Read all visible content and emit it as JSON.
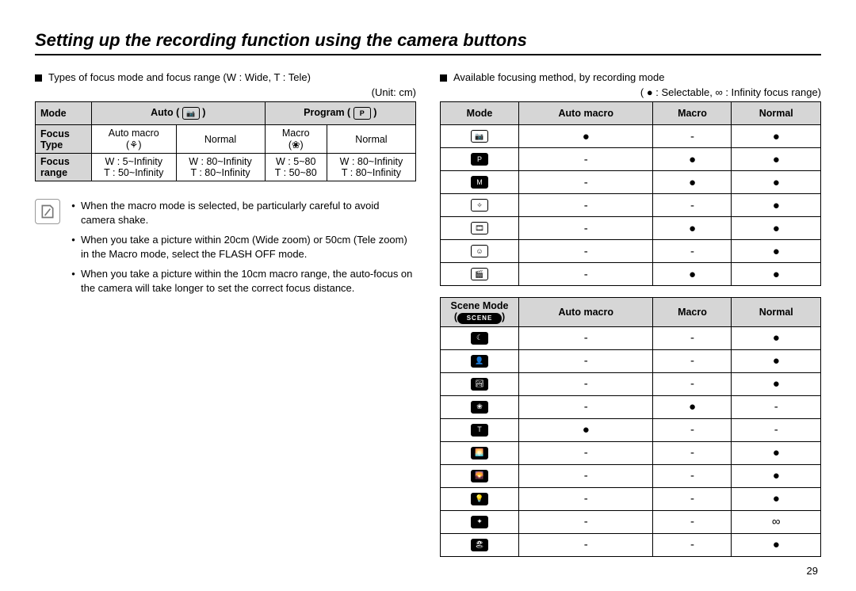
{
  "title": "Setting up the recording function using the camera buttons",
  "pageNumber": "29",
  "left": {
    "heading": "Types of focus mode and focus range (W : Wide, T : Tele)",
    "unitLabel": "(Unit: cm)",
    "table": {
      "row0": {
        "c0": "Mode",
        "c12": "Auto (",
        "c12_icon": "📷",
        "c12_close": ")",
        "c34": "Program (",
        "c34_icon": "P",
        "c34_close": ")"
      },
      "row1": {
        "c0a": "Focus",
        "c0b": "Type",
        "c1a": "Auto macro",
        "c1b_icon": "⚘",
        "c2": "Normal",
        "c3a": "Macro",
        "c3b_icon": "❀",
        "c4": "Normal"
      },
      "row2": {
        "c0a": "Focus",
        "c0b": "range",
        "c1a": "W : 5~Infinity",
        "c1b": "T  : 50~Infinity",
        "c2a": "W : 80~Infinity",
        "c2b": "T  : 80~Infinity",
        "c3a": "W : 5~80",
        "c3b": "T  : 50~80",
        "c4a": "W : 80~Infinity",
        "c4b": "T  : 80~Infinity"
      }
    },
    "notes": [
      "When the macro mode is selected, be particularly careful to avoid camera shake.",
      "When you take a picture within 20cm (Wide zoom) or 50cm (Tele zoom) in the Macro mode, select the FLASH OFF mode.",
      "When you take a picture within the 10cm macro range, the auto-focus on the camera will take longer to set the correct focus distance."
    ]
  },
  "right": {
    "heading": "Available focusing method, by recording mode",
    "legend_pre": "( ● : Selectable,  ",
    "legend_inf": "∞",
    "legend_post": " : Infinity focus range)",
    "tableA": {
      "head": {
        "c0": "Mode",
        "c1": "Auto macro",
        "c2": "Macro",
        "c3": "Normal"
      },
      "rows": [
        {
          "icon": "📷",
          "filled": false,
          "c1": "●",
          "c2": "-",
          "c3": "●"
        },
        {
          "icon": "P",
          "filled": true,
          "c1": "-",
          "c2": "●",
          "c3": "●"
        },
        {
          "icon": "M",
          "filled": true,
          "c1": "-",
          "c2": "●",
          "c3": "●"
        },
        {
          "icon": "✧",
          "filled": false,
          "c1": "-",
          "c2": "-",
          "c3": "●"
        },
        {
          "icon": "🎞",
          "filled": false,
          "c1": "-",
          "c2": "●",
          "c3": "●"
        },
        {
          "icon": "☺",
          "filled": false,
          "c1": "-",
          "c2": "-",
          "c3": "●"
        },
        {
          "icon": "🎬",
          "filled": false,
          "c1": "-",
          "c2": "●",
          "c3": "●"
        }
      ]
    },
    "tableB": {
      "head": {
        "c0a": "Scene Mode",
        "c0b_icon": "SCENE",
        "c1": "Auto macro",
        "c2": "Macro",
        "c3": "Normal"
      },
      "rows": [
        {
          "icon": "☾",
          "filled": true,
          "c1": "-",
          "c2": "-",
          "c3": "●"
        },
        {
          "icon": "👤",
          "filled": true,
          "c1": "-",
          "c2": "-",
          "c3": "●"
        },
        {
          "icon": "🏞",
          "filled": true,
          "c1": "-",
          "c2": "-",
          "c3": "●"
        },
        {
          "icon": "❀",
          "filled": true,
          "c1": "-",
          "c2": "●",
          "c3": "-"
        },
        {
          "icon": "T",
          "filled": true,
          "c1": "●",
          "c2": "-",
          "c3": "-"
        },
        {
          "icon": "🌅",
          "filled": true,
          "c1": "-",
          "c2": "-",
          "c3": "●"
        },
        {
          "icon": "🌄",
          "filled": true,
          "c1": "-",
          "c2": "-",
          "c3": "●"
        },
        {
          "icon": "💡",
          "filled": true,
          "c1": "-",
          "c2": "-",
          "c3": "●"
        },
        {
          "icon": "✦",
          "filled": true,
          "c1": "-",
          "c2": "-",
          "c3": "∞"
        },
        {
          "icon": "🏖",
          "filled": true,
          "c1": "-",
          "c2": "-",
          "c3": "●"
        }
      ]
    }
  }
}
